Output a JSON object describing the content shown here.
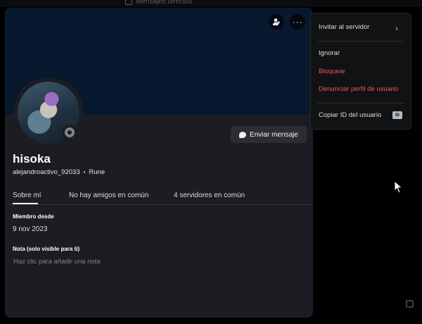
{
  "background": {
    "title": "Mensajes directos"
  },
  "profile": {
    "display_name": "hisoka",
    "username": "alejandroactivo_92033",
    "separator": "•",
    "pronoun_tag": "Rune",
    "status": "offline",
    "banner_color": "#07182f",
    "send_message_label": "Enviar mensaje",
    "more_glyph": "···"
  },
  "tabs": [
    {
      "label": "Sobre mí",
      "active": true
    },
    {
      "label": "No hay amigos en común",
      "active": false
    },
    {
      "label": "4 servidores en común",
      "active": false
    }
  ],
  "sections": {
    "member_since_title": "Miembro desde",
    "member_since_value": "9 nov 2023",
    "note_title": "Nota (solo visible para ti)",
    "note_placeholder": "Haz clic para añadir una nota"
  },
  "context_menu": {
    "items": [
      {
        "label": "Invitar al servidor",
        "danger": false
      },
      {
        "label": "Ignorar",
        "danger": false
      },
      {
        "label": "Bloquear",
        "danger": true
      },
      {
        "label": "Denunciar perfil de usuario",
        "danger": true
      },
      {
        "label": "Copiar ID del usuario",
        "danger": false
      }
    ],
    "chevron": "›",
    "id_badge": "ID",
    "danger_color": "#f0565c"
  }
}
